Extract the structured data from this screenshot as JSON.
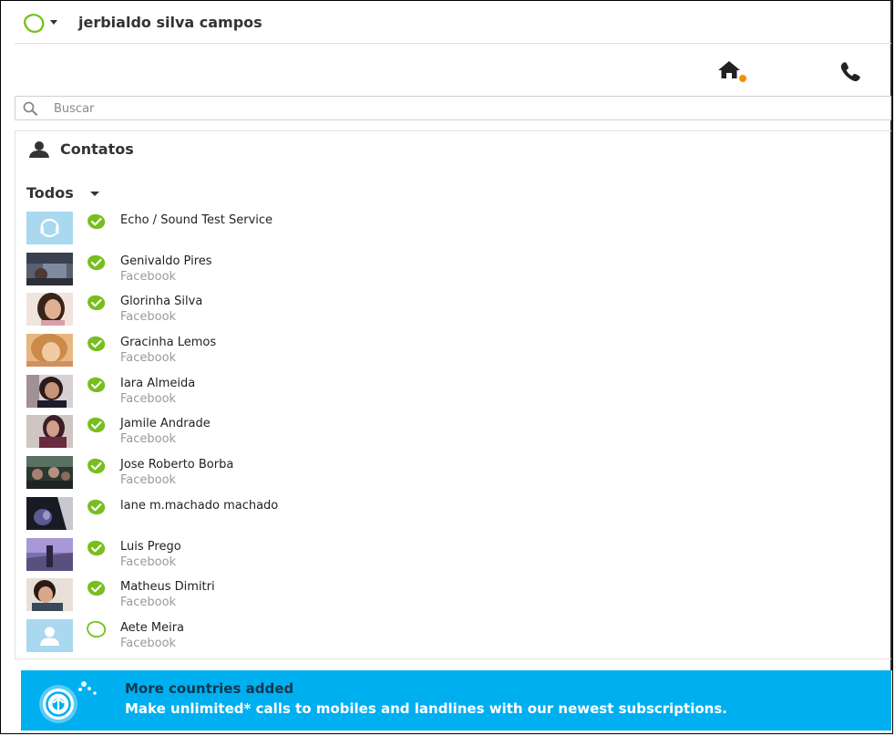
{
  "header": {
    "username": "jerbialdo silva campos",
    "status_icon": "skype-status-online-outline",
    "home_notification": true
  },
  "search": {
    "placeholder": "Buscar",
    "value": ""
  },
  "contacts": {
    "title": "Contatos",
    "filter": "Todos",
    "items": [
      {
        "name": "Echo / Sound Test Service",
        "subtitle": "",
        "status": "online",
        "avatar": "headset-icon"
      },
      {
        "name": "Genivaldo Pires",
        "subtitle": "Facebook",
        "status": "online",
        "avatar": "photo"
      },
      {
        "name": "Glorinha Silva",
        "subtitle": "Facebook",
        "status": "online",
        "avatar": "photo"
      },
      {
        "name": "Gracinha Lemos",
        "subtitle": "Facebook",
        "status": "online",
        "avatar": "photo"
      },
      {
        "name": "Iara Almeida",
        "subtitle": "Facebook",
        "status": "online",
        "avatar": "photo"
      },
      {
        "name": "Jamile Andrade",
        "subtitle": "Facebook",
        "status": "online",
        "avatar": "photo"
      },
      {
        "name": "Jose Roberto Borba",
        "subtitle": "Facebook",
        "status": "online",
        "avatar": "photo"
      },
      {
        "name": "lane m.machado machado",
        "subtitle": "",
        "status": "online",
        "avatar": "photo"
      },
      {
        "name": "Luis Prego",
        "subtitle": "Facebook",
        "status": "online",
        "avatar": "photo"
      },
      {
        "name": "Matheus Dimitri",
        "subtitle": "Facebook",
        "status": "online",
        "avatar": "photo"
      },
      {
        "name": "Aete Meira",
        "subtitle": "Facebook",
        "status": "offline",
        "avatar": "default-person-icon"
      }
    ]
  },
  "banner": {
    "title": "More countries added",
    "text": "Make unlimited* calls to mobiles and landlines with our newest subscriptions."
  },
  "colors": {
    "online_green": "#78be20",
    "banner_blue": "#00aff0",
    "notification_orange": "#f39200",
    "default_avatar": "#a9d8ef"
  }
}
